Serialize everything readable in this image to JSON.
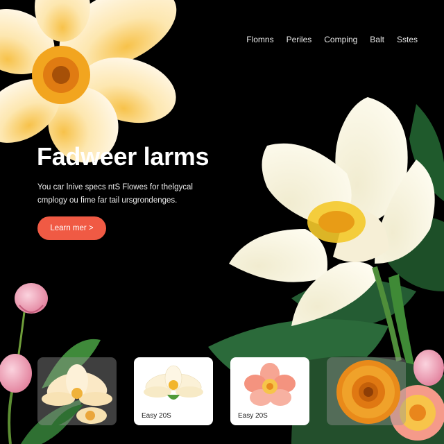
{
  "nav": {
    "items": [
      "Flomns",
      "Periles",
      "Comping",
      "Balt",
      "Sstes"
    ]
  },
  "hero": {
    "title": "Fadweer larms",
    "description_line1": "You car lnive specs ntS Flowes for thelgycal",
    "description_line2": "cmplogy ou fime far tail ursgrondenges.",
    "cta_label": "Learn mer >"
  },
  "cards": [
    {
      "caption": ""
    },
    {
      "caption": "Easy 20S"
    },
    {
      "caption": "Easy 20S"
    },
    {
      "caption": ""
    }
  ],
  "colors": {
    "background": "#000000",
    "accent": "#f05a44",
    "card_light": "#ffffff"
  },
  "icons": {
    "hero_flower_top": "yellow-flower-icon",
    "hero_flower_right": "white-magnolia-icon",
    "buds": "pink-tulip-icon",
    "card1": "cream-lotus-icon",
    "card2": "white-lotus-icon",
    "card3": "pink-flower-icon",
    "card4": "orange-daisy-icon"
  }
}
